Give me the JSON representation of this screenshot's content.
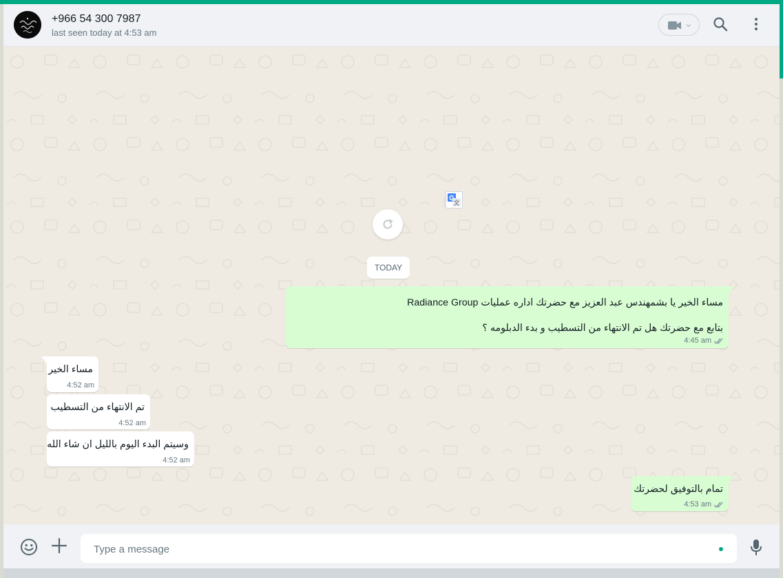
{
  "colors": {
    "accent": "#00a884",
    "outgoing_bubble": "#d9fdd3",
    "incoming_bubble": "#ffffff",
    "chat_background": "#efeae2",
    "read_ticks": "#8696a0"
  },
  "header": {
    "contact_name": "+966 54 300 7987",
    "status": "last seen today at 4:53 am",
    "video_icon": "video-camera-icon",
    "search_icon": "search-icon",
    "menu_icon": "kebab-menu-icon"
  },
  "chat": {
    "date_badge": "TODAY",
    "messages": [
      {
        "direction": "out",
        "lines": [
          "مساء الخير يا بشمهندس عبد العزيز مع  حضرتك اداره عمليات Radiance Group",
          "",
          "بتابع مع حضرتك هل تم الانتهاء من التسطيب و بدء الدبلومه ؟"
        ],
        "time": "4:45 am",
        "status": "read"
      },
      {
        "direction": "in",
        "lines": [
          "مساء الخير"
        ],
        "time": "4:52 am"
      },
      {
        "direction": "in",
        "lines": [
          "تم الانتهاء من التسطيب"
        ],
        "time": "4:52 am"
      },
      {
        "direction": "in",
        "lines": [
          "وسيتم البدء اليوم بالليل ان شاء الله"
        ],
        "time": "4:52 am"
      },
      {
        "direction": "out",
        "lines": [
          "تمام بالتوفيق لحضرتك"
        ],
        "time": "4:53 am",
        "status": "read"
      }
    ]
  },
  "footer": {
    "placeholder": "Type a message",
    "emoji_icon": "emoji-icon",
    "attach_icon": "plus-icon",
    "mic_icon": "microphone-icon"
  }
}
